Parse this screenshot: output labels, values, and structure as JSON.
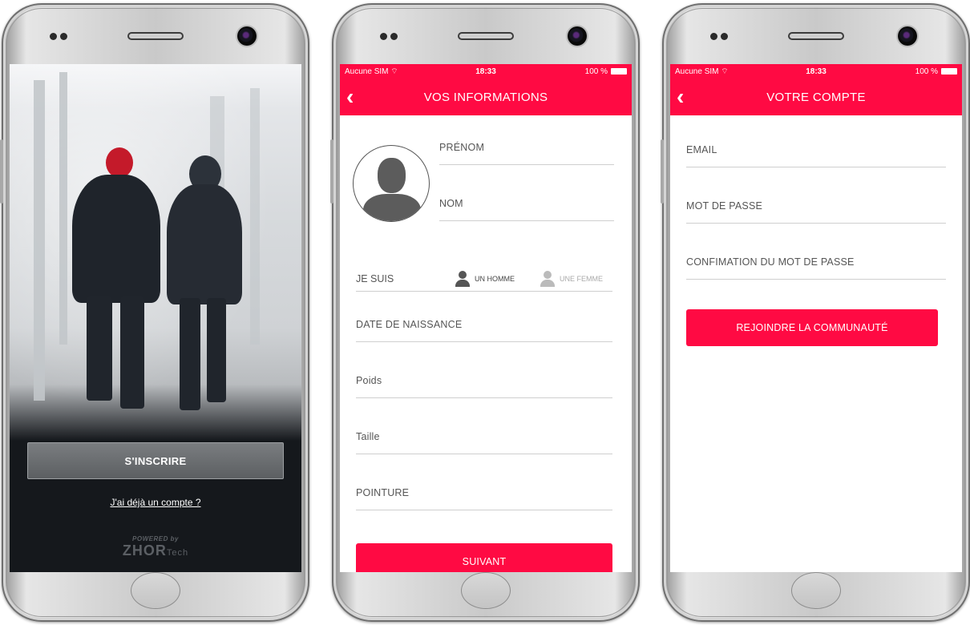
{
  "colors": {
    "accent": "#ff0a43",
    "dark_bg": "#15181c"
  },
  "screen1": {
    "signup_button": "S'INSCRIRE",
    "login_link": "J'ai déjà un compte ?",
    "powered_by": "POWERED by",
    "brand_main": "ZHOR",
    "brand_suffix": "Tech"
  },
  "status_bar": {
    "carrier": "Aucune SIM",
    "wifi_icon": "wifi-icon",
    "time": "18:33",
    "battery": "100 %"
  },
  "screen2": {
    "title": "VOS INFORMATIONS",
    "fields": {
      "prenom": "PRÉNOM",
      "nom": "NOM",
      "date_naissance": "DATE DE NAISSANCE",
      "poids": "Poids",
      "taille": "Taille",
      "pointure": "POINTURE"
    },
    "gender": {
      "label": "JE SUIS",
      "male": "UN HOMME",
      "female": "UNE FEMME"
    },
    "next_button": "SUIVANT"
  },
  "screen3": {
    "title": "VOTRE COMPTE",
    "fields": {
      "email": "EMAIL",
      "password": "MOT DE PASSE",
      "confirm": "CONFIMATION DU MOT DE PASSE"
    },
    "join_button": "REJOINDRE LA COMMUNAUTÉ"
  }
}
